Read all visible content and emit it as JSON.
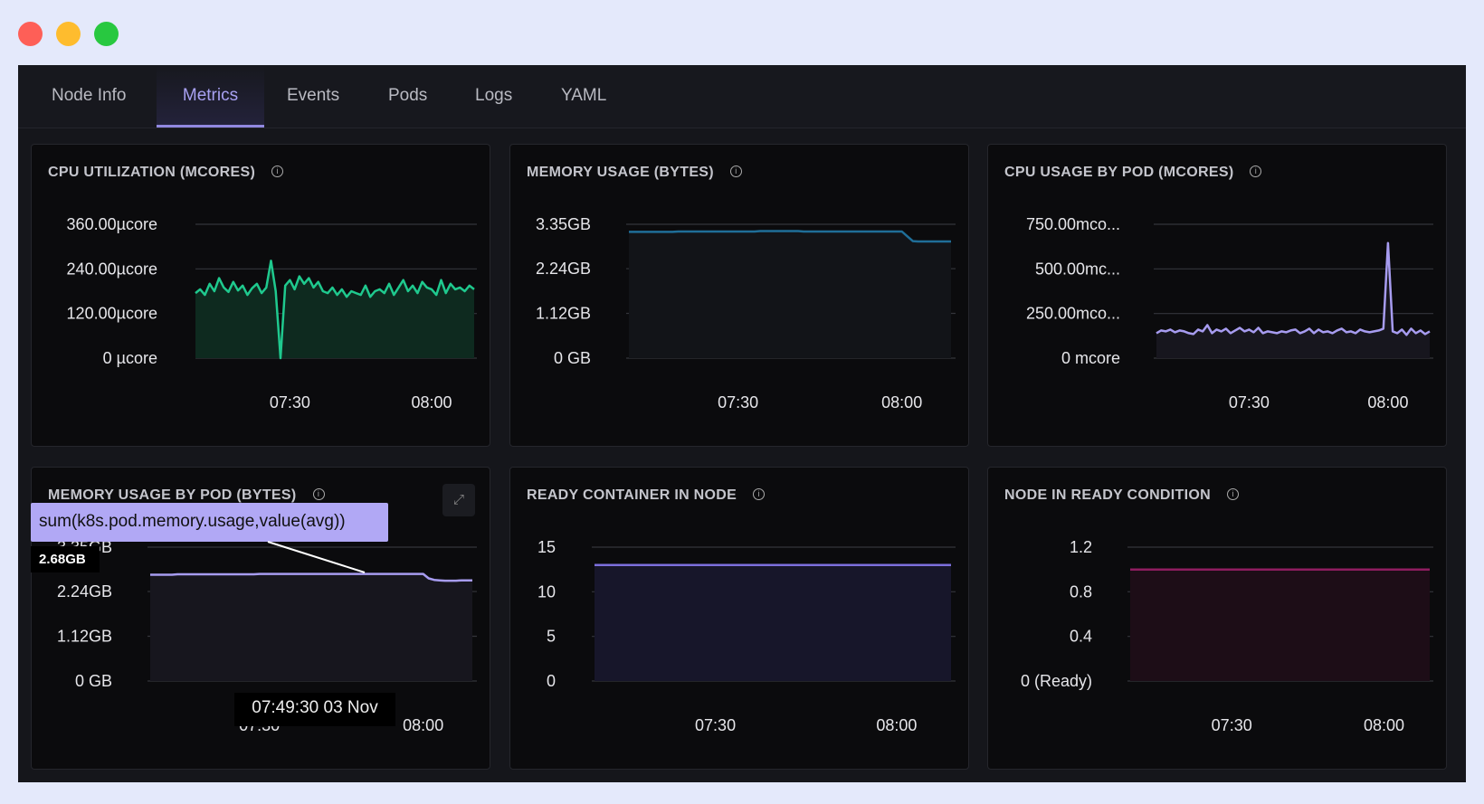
{
  "window": {
    "controls": [
      {
        "name": "close",
        "color": "#fe5f57"
      },
      {
        "name": "minimize",
        "color": "#febc2e"
      },
      {
        "name": "maximize",
        "color": "#28c840"
      }
    ]
  },
  "tabs": [
    {
      "label": "Node Info",
      "active": false
    },
    {
      "label": "Metrics",
      "active": true
    },
    {
      "label": "Events",
      "active": false
    },
    {
      "label": "Pods",
      "active": false
    },
    {
      "label": "Logs",
      "active": false
    },
    {
      "label": "YAML",
      "active": false
    }
  ],
  "chart_data": [
    {
      "type": "area",
      "title": "CPU UTILIZATION (MCORES)",
      "color": "#1fc98e",
      "fill": "#0e2a1f",
      "yticks": [
        {
          "v": 0,
          "label": "0 µcore"
        },
        {
          "v": 120,
          "label": "120.00µcore"
        },
        {
          "v": 240,
          "label": "240.00µcore"
        },
        {
          "v": 360,
          "label": "360.00µcore"
        }
      ],
      "ylim": [
        0,
        360
      ],
      "xlim": [
        "07:10",
        "08:09"
      ],
      "xticks": [
        "07:30",
        "08:00"
      ],
      "grid": true,
      "values": [
        175,
        185,
        170,
        200,
        180,
        215,
        190,
        178,
        205,
        182,
        195,
        170,
        188,
        200,
        175,
        190,
        262,
        180,
        0,
        195,
        210,
        185,
        220,
        200,
        215,
        190,
        205,
        180,
        175,
        190,
        170,
        185,
        165,
        180,
        175,
        170,
        195,
        165,
        180,
        185,
        175,
        200,
        170,
        190,
        210,
        180,
        195,
        175,
        205,
        190,
        185,
        170,
        210,
        175,
        200,
        185,
        190,
        180,
        195,
        185
      ]
    },
    {
      "type": "area",
      "title": "MEMORY USAGE (BYTES)",
      "color": "#1f6e98",
      "fill": "#121418",
      "yticks": [
        {
          "v": 0,
          "label": "0 GB"
        },
        {
          "v": 1.12,
          "label": "1.12GB"
        },
        {
          "v": 2.24,
          "label": "2.24GB"
        },
        {
          "v": 3.35,
          "label": "3.35GB"
        }
      ],
      "ylim": [
        0,
        3.35
      ],
      "xlim": [
        "07:10",
        "08:09"
      ],
      "xticks": [
        "07:30",
        "08:00"
      ],
      "grid": true,
      "values": [
        3.16,
        3.16,
        3.16,
        3.16,
        3.16,
        3.16,
        3.16,
        3.16,
        3.16,
        3.17,
        3.17,
        3.17,
        3.17,
        3.17,
        3.17,
        3.17,
        3.17,
        3.17,
        3.17,
        3.17,
        3.17,
        3.17,
        3.17,
        3.17,
        3.18,
        3.18,
        3.18,
        3.18,
        3.18,
        3.18,
        3.18,
        3.18,
        3.17,
        3.17,
        3.17,
        3.17,
        3.17,
        3.17,
        3.17,
        3.17,
        3.17,
        3.17,
        3.17,
        3.17,
        3.17,
        3.17,
        3.17,
        3.17,
        3.17,
        3.17,
        3.17,
        3.05,
        2.93,
        2.92,
        2.92,
        2.92,
        2.92,
        2.92,
        2.92,
        2.92
      ]
    },
    {
      "type": "area",
      "title": "CPU USAGE BY POD (MCORES)",
      "color": "#a79cf0",
      "fill": "#17161e",
      "yticks": [
        {
          "v": 0,
          "label": "0 mcore"
        },
        {
          "v": 250,
          "label": "250.00mco..."
        },
        {
          "v": 500,
          "label": "500.00mc..."
        },
        {
          "v": 750,
          "label": "750.00mco..."
        }
      ],
      "ylim": [
        0,
        750
      ],
      "xlim": [
        "07:10",
        "08:09"
      ],
      "xticks": [
        "07:30",
        "08:00"
      ],
      "grid": true,
      "values": [
        140,
        155,
        150,
        160,
        145,
        155,
        150,
        140,
        135,
        160,
        150,
        185,
        140,
        160,
        150,
        165,
        140,
        155,
        170,
        150,
        160,
        145,
        170,
        140,
        150,
        145,
        140,
        150,
        145,
        155,
        160,
        140,
        150,
        165,
        140,
        160,
        145,
        150,
        140,
        155,
        165,
        145,
        150,
        140,
        160,
        150,
        145,
        150,
        155,
        165,
        645,
        150,
        140,
        160,
        130,
        165,
        140,
        155,
        135,
        150
      ]
    },
    {
      "type": "area",
      "title": "MEMORY USAGE BY POD (BYTES)",
      "color": "#a79cf0",
      "fill": "#17161e",
      "yticks": [
        {
          "v": 0,
          "label": "0 GB"
        },
        {
          "v": 1.12,
          "label": "1.12GB"
        },
        {
          "v": 2.24,
          "label": "2.24GB"
        },
        {
          "v": 3.35,
          "label": "3.35GB"
        }
      ],
      "ylim": [
        0,
        3.35
      ],
      "xlim": [
        "07:10",
        "08:09"
      ],
      "xticks": [
        "07:30",
        "08:00"
      ],
      "grid": true,
      "values": [
        2.66,
        2.66,
        2.66,
        2.66,
        2.66,
        2.67,
        2.67,
        2.67,
        2.67,
        2.67,
        2.67,
        2.67,
        2.67,
        2.67,
        2.67,
        2.67,
        2.67,
        2.67,
        2.67,
        2.67,
        2.68,
        2.68,
        2.68,
        2.68,
        2.68,
        2.68,
        2.68,
        2.68,
        2.68,
        2.68,
        2.68,
        2.68,
        2.68,
        2.68,
        2.68,
        2.68,
        2.68,
        2.68,
        2.68,
        2.68,
        2.68,
        2.68,
        2.68,
        2.68,
        2.68,
        2.68,
        2.68,
        2.68,
        2.68,
        2.68,
        2.68,
        2.57,
        2.53,
        2.52,
        2.51,
        2.51,
        2.51,
        2.52,
        2.52,
        2.52
      ],
      "tooltip": {
        "series": "sum(k8s.pod.memory.usage,value(avg))",
        "value": "2.68GB",
        "time": "07:49:30 03 Nov"
      },
      "expand_icon": "expand-icon"
    },
    {
      "type": "area",
      "title": "READY CONTAINER IN NODE",
      "color": "#7c6fdc",
      "fill": "#17162a",
      "yticks": [
        {
          "v": 0,
          "label": "0"
        },
        {
          "v": 5,
          "label": "5"
        },
        {
          "v": 10,
          "label": "10"
        },
        {
          "v": 15,
          "label": "15"
        }
      ],
      "ylim": [
        0,
        15
      ],
      "xlim": [
        "07:10",
        "08:09"
      ],
      "xticks": [
        "07:30",
        "08:00"
      ],
      "grid": true,
      "values": [
        13,
        13
      ]
    },
    {
      "type": "area",
      "title": "NODE IN READY CONDITION",
      "color": "#8f1d60",
      "fill": "#1d0d17",
      "yticks": [
        {
          "v": 0,
          "label": "0 (Ready)"
        },
        {
          "v": 0.4,
          "label": "0.4"
        },
        {
          "v": 0.8,
          "label": "0.8"
        },
        {
          "v": 1.2,
          "label": "1.2"
        }
      ],
      "ylim": [
        0,
        1.2
      ],
      "xlim": [
        "07:10",
        "08:09"
      ],
      "xticks": [
        "07:30",
        "08:00"
      ],
      "grid": true,
      "values": [
        1.0,
        1.0
      ]
    }
  ]
}
